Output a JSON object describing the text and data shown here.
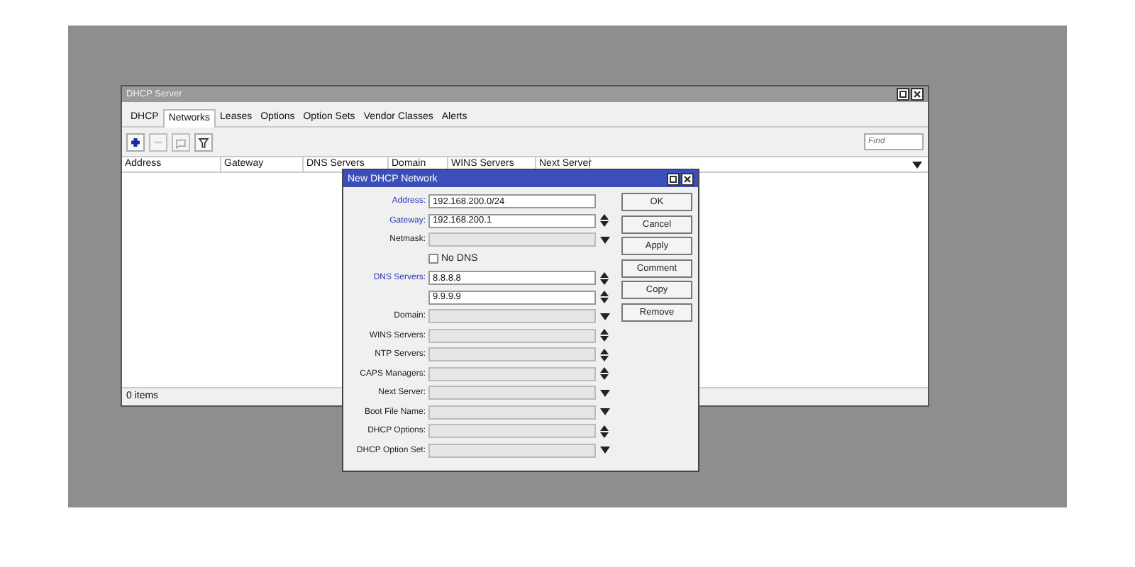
{
  "window": {
    "title": "DHCP Server"
  },
  "tabs": [
    {
      "label": "DHCP",
      "selected": false
    },
    {
      "label": "Networks",
      "selected": true
    },
    {
      "label": "Leases",
      "selected": false
    },
    {
      "label": "Options",
      "selected": false
    },
    {
      "label": "Option Sets",
      "selected": false
    },
    {
      "label": "Vendor Classes",
      "selected": false
    },
    {
      "label": "Alerts",
      "selected": false
    }
  ],
  "toolbar": {
    "buttons": [
      {
        "kind": "add",
        "disabled": false
      },
      {
        "kind": "remove",
        "disabled": true
      },
      {
        "kind": "comment",
        "disabled": true
      },
      {
        "kind": "filter",
        "disabled": false
      }
    ],
    "search": {
      "placeholder": "Find"
    }
  },
  "table": {
    "columns": [
      "Address",
      "Gateway",
      "DNS Servers",
      "Domain",
      "WINS Servers",
      "Next Server"
    ]
  },
  "status_bar": "0 items",
  "dialog": {
    "title": "New DHCP Network",
    "rows": [
      {
        "kind": "field",
        "label": "Address:",
        "value": "192.168.200.0/24",
        "enabled": true,
        "highlighted": true
      },
      {
        "kind": "field",
        "label": "Gateway:",
        "value": "192.168.200.1",
        "enabled": true,
        "highlighted": true,
        "control": {
          "kind": "updown"
        }
      },
      {
        "kind": "field",
        "label": "Netmask:",
        "enabled": false,
        "highlighted": false,
        "control": {
          "kind": "dropdown"
        }
      },
      {
        "kind": "checkbox",
        "label": "No DNS",
        "checked": false
      },
      {
        "kind": "field",
        "label": "DNS Servers:",
        "value": "8.8.8.8",
        "enabled": true,
        "highlighted": true,
        "control": {
          "kind": "updown"
        }
      },
      {
        "kind": "field",
        "value": "9.9.9.9",
        "enabled": true,
        "control": {
          "kind": "updown"
        }
      },
      {
        "kind": "field",
        "label": "Domain:",
        "enabled": false,
        "highlighted": false,
        "control": {
          "kind": "dropdown"
        }
      },
      {
        "kind": "field",
        "label": "WINS Servers:",
        "enabled": false,
        "highlighted": false,
        "control": {
          "kind": "updown"
        }
      },
      {
        "kind": "field",
        "label": "NTP Servers:",
        "enabled": false,
        "highlighted": false,
        "control": {
          "kind": "updown"
        }
      },
      {
        "kind": "field",
        "label": "CAPS Managers:",
        "enabled": false,
        "highlighted": false,
        "control": {
          "kind": "updown"
        }
      },
      {
        "kind": "field",
        "label": "Next Server:",
        "enabled": false,
        "highlighted": false,
        "control": {
          "kind": "dropdown"
        }
      },
      {
        "kind": "field",
        "label": "Boot File Name:",
        "enabled": false,
        "highlighted": false,
        "control": {
          "kind": "dropdown"
        }
      },
      {
        "kind": "field",
        "label": "DHCP Options:",
        "enabled": false,
        "highlighted": false,
        "control": {
          "kind": "updown"
        }
      },
      {
        "kind": "field",
        "label": "DHCP Option Set:",
        "enabled": false,
        "highlighted": false,
        "control": {
          "kind": "dropdown"
        }
      }
    ],
    "buttons": [
      "OK",
      "Cancel",
      "Apply",
      "Comment",
      "Copy",
      "Remove"
    ]
  }
}
